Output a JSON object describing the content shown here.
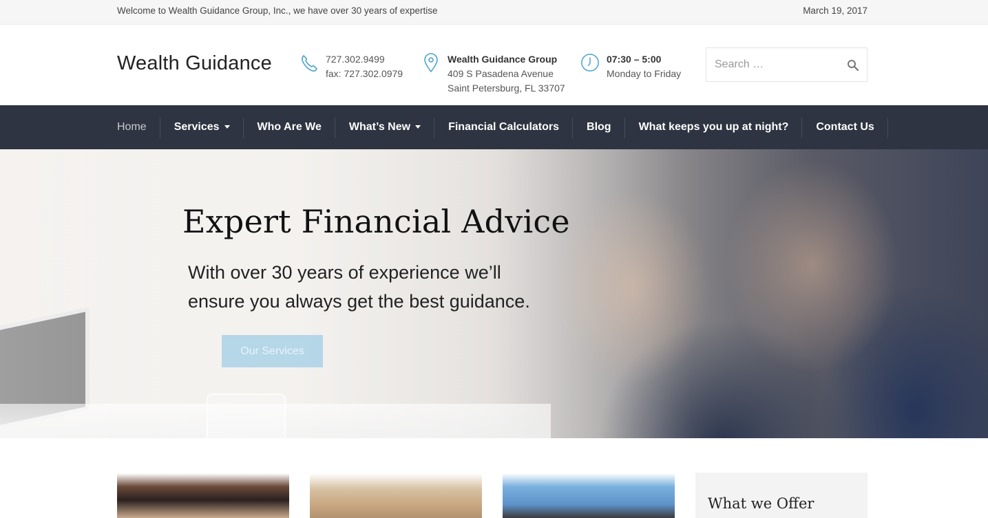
{
  "topbar": {
    "welcome": "Welcome to Wealth Guidance Group, Inc., we have over 30 years of expertise",
    "date": "March 19, 2017"
  },
  "header": {
    "logo": "Wealth Guidance",
    "phone": {
      "icon": "phone-icon",
      "line1": "727.302.9499",
      "line2": "fax: 727.302.0979"
    },
    "address": {
      "icon": "map-pin-icon",
      "line1": "Wealth Guidance Group",
      "line2": "409 S Pasadena Avenue",
      "line3": "Saint Petersburg, FL 33707"
    },
    "hours": {
      "icon": "clock-icon",
      "line1": "07:30 – 5:00",
      "line2": "Monday to Friday"
    },
    "search": {
      "placeholder": "Search …",
      "icon": "search-icon"
    }
  },
  "nav": {
    "items": [
      {
        "label": "Home",
        "active": true,
        "dropdown": false
      },
      {
        "label": "Services",
        "active": false,
        "dropdown": true
      },
      {
        "label": "Who Are We",
        "active": false,
        "dropdown": false
      },
      {
        "label": "What’s New",
        "active": false,
        "dropdown": true
      },
      {
        "label": "Financial Calculators",
        "active": false,
        "dropdown": false
      },
      {
        "label": "Blog",
        "active": false,
        "dropdown": false
      },
      {
        "label": "What keeps you up at night?",
        "active": false,
        "dropdown": false
      },
      {
        "label": "Contact Us",
        "active": false,
        "dropdown": false
      }
    ]
  },
  "hero": {
    "title": "Expert Financial Advice",
    "subtitle": "With over 30 years of experience we’ll ensure you always get the best guidance.",
    "button": "Our Services"
  },
  "sidebar": {
    "title": "What we Offer"
  },
  "colors": {
    "accent": "#4aa3cf",
    "nav_bg": "#2e3441",
    "button": "#a0cde6"
  }
}
